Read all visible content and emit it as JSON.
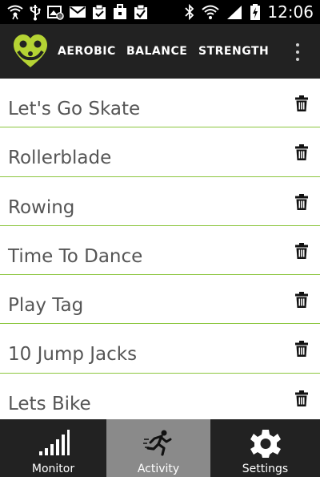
{
  "status_bar": {
    "time": "12:06",
    "icons": [
      "wifi-hotspot-icon",
      "usb-icon",
      "picture-notification-icon",
      "gmail-icon",
      "clipboard-check-icon",
      "briefcase-icon",
      "clipboard-done-icon",
      "bluetooth-icon",
      "wifi-icon",
      "signal-icon",
      "battery-charging-icon"
    ]
  },
  "action_bar": {
    "logo_icon": "heart-family-logo",
    "tabs": [
      {
        "label": "AEROBIC"
      },
      {
        "label": "BALANCE"
      },
      {
        "label": "STRENGTH"
      }
    ],
    "overflow_icon": "overflow-menu-icon"
  },
  "activities": [
    {
      "label": "Let's Go Skate"
    },
    {
      "label": "Rollerblade"
    },
    {
      "label": "Rowing"
    },
    {
      "label": "Time To Dance"
    },
    {
      "label": "Play Tag"
    },
    {
      "label": "10 Jump Jacks"
    },
    {
      "label": "Lets Bike"
    }
  ],
  "bottom_nav": {
    "items": [
      {
        "label": "Monitor",
        "icon": "bar-chart-icon",
        "active": false
      },
      {
        "label": "Activity",
        "icon": "runner-icon",
        "active": true
      },
      {
        "label": "Settings",
        "icon": "gear-icon",
        "active": false
      }
    ]
  },
  "colors": {
    "accent_green": "#8cc63f",
    "logo_green": "#b5d334",
    "bar_dark": "#222222",
    "nav_active": "#8a8a8a",
    "list_text": "#555555"
  }
}
